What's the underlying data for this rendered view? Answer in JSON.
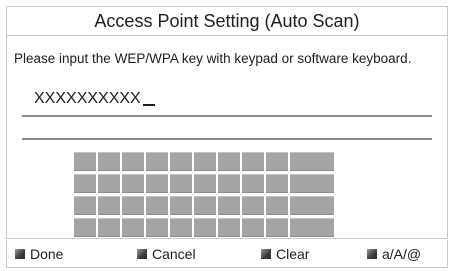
{
  "title": "Access Point Setting (Auto Scan)",
  "instruction": "Please input the WEP/WPA key with keypad or software keyboard.",
  "key_input": {
    "value": "XXXXXXXXXX"
  },
  "keypad": {
    "rows": 4,
    "columns": 10
  },
  "footer": {
    "buttons": [
      {
        "label": "Done",
        "icon": "button-marker-icon"
      },
      {
        "label": "Cancel",
        "icon": "button-marker-icon"
      },
      {
        "label": "Clear",
        "icon": "button-marker-icon"
      },
      {
        "label": "a/A/@",
        "icon": "button-marker-icon"
      }
    ]
  },
  "colors": {
    "background": "#ffffff",
    "key": "#a4a4a4",
    "border": "#c8c8c8",
    "text": "#1e1e1e"
  }
}
